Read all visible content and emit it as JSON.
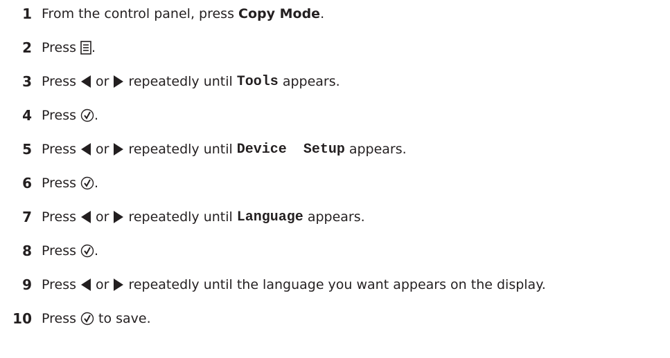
{
  "steps": [
    {
      "num": "1",
      "t1": "From the control panel, press ",
      "bold": "Copy Mode",
      "t2": "."
    },
    {
      "num": "2",
      "t1": "Press",
      "icon": "menu-icon",
      "t2": "."
    },
    {
      "num": "3",
      "t1": "Press",
      "or": "or",
      "t2": "repeatedly until",
      "code": "Tools",
      "t3": "appears."
    },
    {
      "num": "4",
      "t1": "Press",
      "icon": "select-check-icon",
      "t2": "."
    },
    {
      "num": "5",
      "t1": "Press",
      "or": "or",
      "t2": "repeatedly until",
      "code": "Device  Setup",
      "t3": "appears."
    },
    {
      "num": "6",
      "t1": "Press",
      "icon": "select-check-icon",
      "t2": "."
    },
    {
      "num": "7",
      "t1": "Press",
      "or": "or",
      "t2": "repeatedly until",
      "code": "Language",
      "t3": "appears."
    },
    {
      "num": "8",
      "t1": "Press",
      "icon": "select-check-icon",
      "t2": "."
    },
    {
      "num": "9",
      "t1": "Press",
      "or": "or",
      "t2": "repeatedly until the language you want appears on the display."
    },
    {
      "num": "10",
      "t1": "Press",
      "icon": "select-check-icon",
      "t2": "to save."
    }
  ],
  "icons": {
    "left": "left-arrow-icon",
    "right": "right-arrow-icon",
    "menu": "menu-icon",
    "select": "select-check-icon"
  },
  "colors": {
    "text": "#231f20",
    "background": "#ffffff"
  }
}
